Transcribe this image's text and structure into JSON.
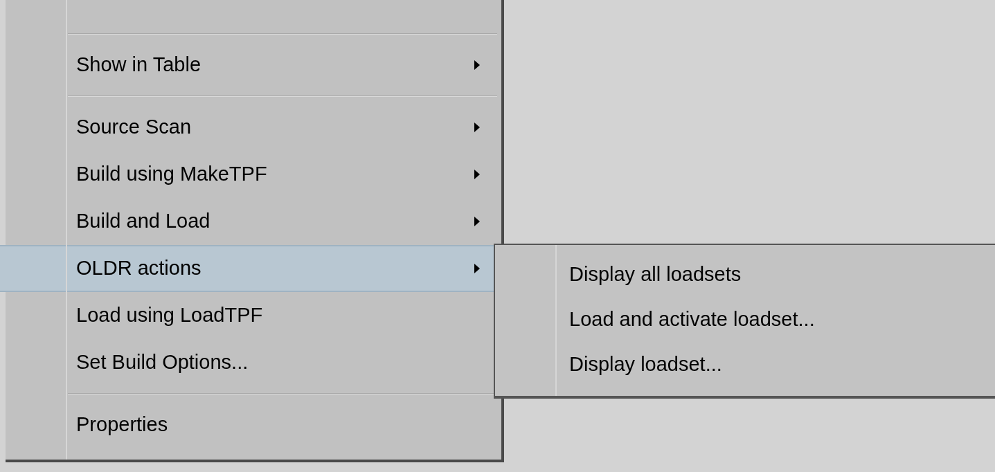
{
  "context_menu": {
    "items": [
      {
        "kind": "separator"
      },
      {
        "kind": "item",
        "label": "Show in Table",
        "has_submenu": true,
        "selected": false
      },
      {
        "kind": "separator"
      },
      {
        "kind": "item",
        "label": "Source Scan",
        "has_submenu": true,
        "selected": false
      },
      {
        "kind": "item",
        "label": "Build using MakeTPF",
        "has_submenu": true,
        "selected": false
      },
      {
        "kind": "item",
        "label": "Build and Load",
        "has_submenu": true,
        "selected": false
      },
      {
        "kind": "item",
        "label": "OLDR actions",
        "has_submenu": true,
        "selected": true
      },
      {
        "kind": "item",
        "label": "Load using LoadTPF",
        "has_submenu": false,
        "selected": false
      },
      {
        "kind": "item",
        "label": "Set Build Options...",
        "has_submenu": false,
        "selected": false
      },
      {
        "kind": "separator"
      },
      {
        "kind": "item",
        "label": "Properties",
        "has_submenu": false,
        "selected": false
      }
    ]
  },
  "submenu": {
    "items": [
      {
        "label": "Display all loadsets"
      },
      {
        "label": "Load and activate loadset..."
      },
      {
        "label": "Display loadset..."
      }
    ]
  }
}
